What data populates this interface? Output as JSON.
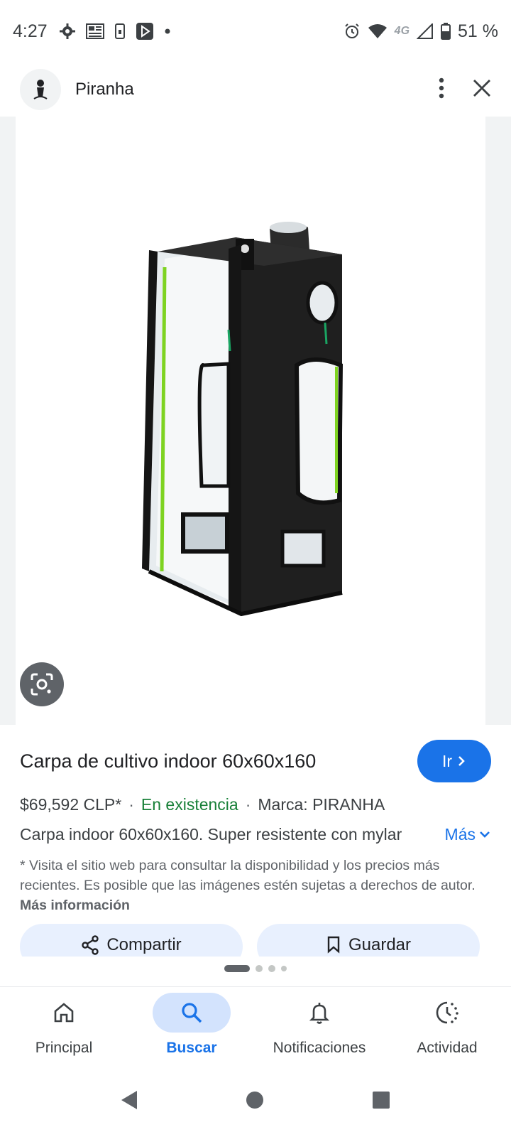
{
  "status_bar": {
    "time": "4:27",
    "network": "4G",
    "battery": "51 %"
  },
  "header": {
    "site_name": "Piranha"
  },
  "product": {
    "title": "Carpa de cultivo indoor 60x60x160",
    "go_label": "Ir",
    "price": "$69,592 CLP*",
    "availability": "En existencia",
    "brand": "Marca: PIRANHA",
    "description": "Carpa indoor 60x60x160. Super resistente con mylar",
    "more_label": "Más",
    "disclaimer": "* Visita el sitio web para consultar la disponibilidad y los precios más recientes. Es posible que las imágenes estén sujetas a derechos de autor.",
    "more_info_label": "Más información"
  },
  "actions": {
    "share_label": "Compartir",
    "save_label": "Guardar"
  },
  "bottom_nav": {
    "items": [
      {
        "label": "Principal",
        "icon": "home-icon"
      },
      {
        "label": "Buscar",
        "icon": "search-icon"
      },
      {
        "label": "Notificaciones",
        "icon": "bell-icon"
      },
      {
        "label": "Actividad",
        "icon": "activity-icon"
      }
    ],
    "active_index": 1
  },
  "colors": {
    "accent": "#1a73e8",
    "stock_green": "#188038",
    "tent_green": "#7ed321"
  }
}
